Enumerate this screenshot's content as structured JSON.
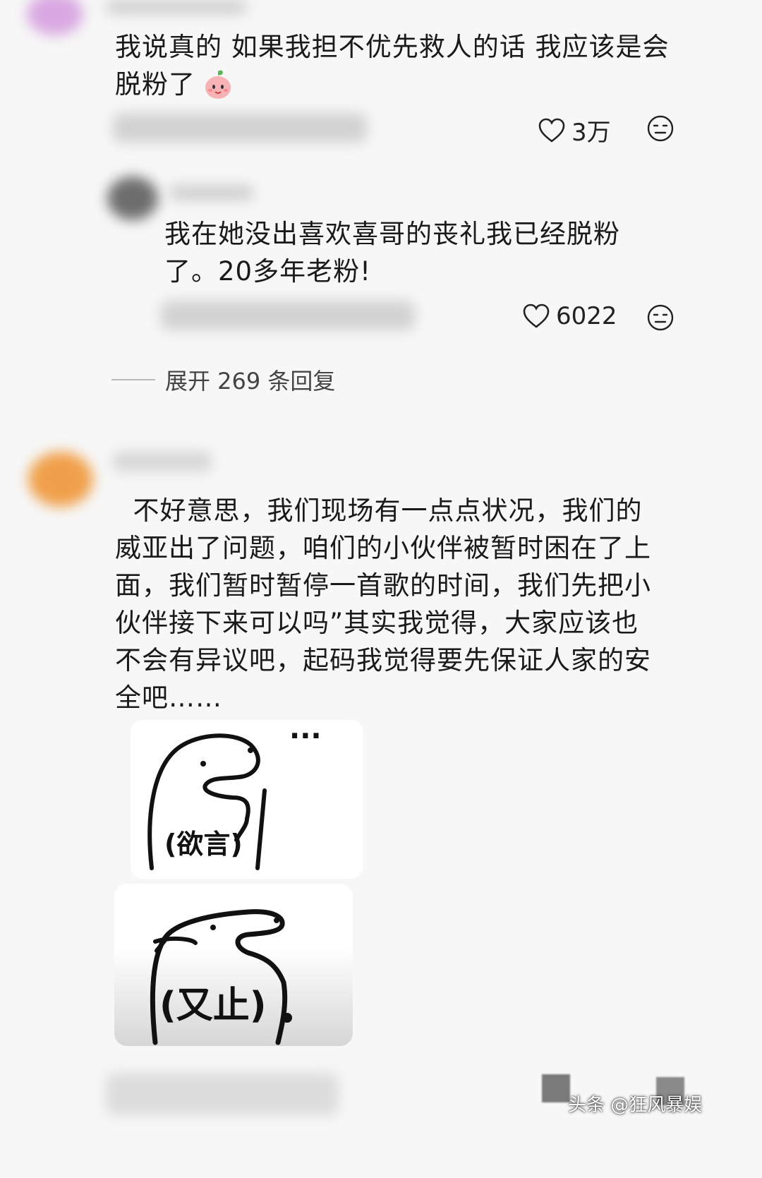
{
  "comments": [
    {
      "text_line1": "我说真的 如果我担不优先救人的话 我应该是会",
      "text_line2": "脱粉了",
      "emoji": "peach-face-emoji",
      "likes": "3万"
    },
    {
      "text_line1": "我在她没出喜欢喜哥的丧礼我已经脱粉",
      "text_line2": "了。20多年老粉!",
      "likes": "6022"
    }
  ],
  "expand_replies": "展开 269 条回复",
  "third_comment": {
    "lines": [
      "  不好意思，我们现场有一点点状况，我们的",
      "威亚出了问题，咱们的小伙伴被暂时困在了上",
      "面，我们暂时暂停一首歌的时间，我们先把小",
      "伙伴接下来可以吗”其实我觉得，大家应该也",
      "不会有异议吧，起码我觉得要先保证人家的安",
      "全吧……"
    ],
    "sticker_top_caption": "(欲言)",
    "sticker_top_dots": "···",
    "sticker_bottom_caption": "(又止)"
  },
  "watermark": "头条 @狂风暴娱",
  "icons": {
    "like": "heart-outline-icon",
    "react": "neutral-face-icon"
  },
  "colors": {
    "background": "#f7f7f7",
    "text": "#1a1a1a",
    "avatar1": "#d7a6e0",
    "avatar3": "#f0a04a"
  }
}
